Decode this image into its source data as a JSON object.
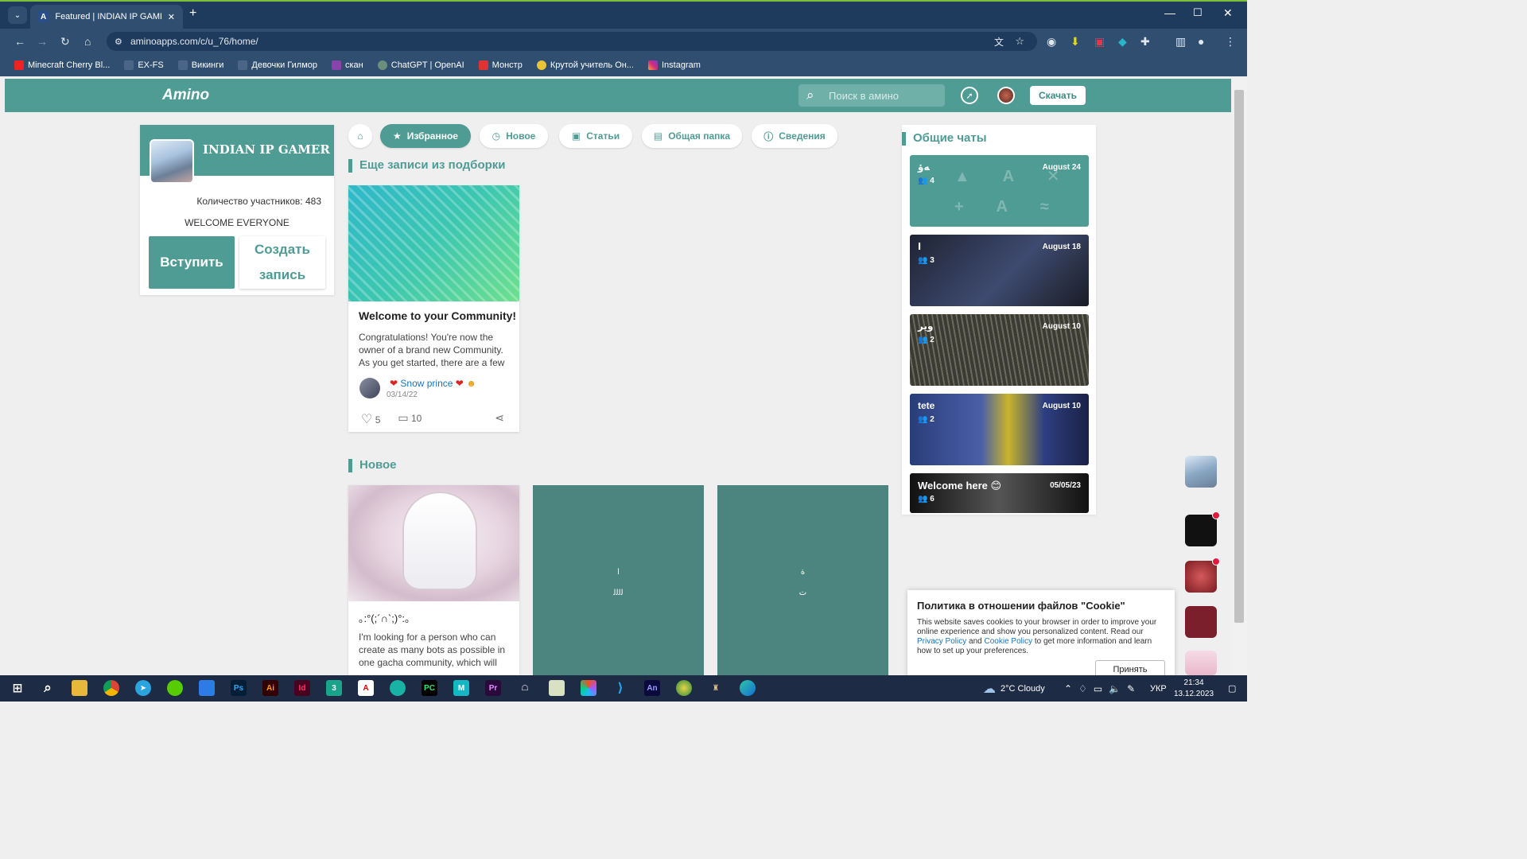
{
  "browser": {
    "tab_title": "Featured | INDIAN IP GAMER /",
    "url": "aminoapps.com/c/u_76/home/",
    "bookmarks": [
      "Minecraft Cherry Bl...",
      "EX-FS",
      "Викинги",
      "Девочки Гилмор",
      "скан",
      "ChatGPT | OpenAI",
      "Монстр",
      "Крутой учитель Он...",
      "Instagram"
    ]
  },
  "header": {
    "logo": "Amino",
    "search_placeholder": "Поиск в амино",
    "download_label": "Скачать"
  },
  "community": {
    "name": "INDIAN IP GAMER",
    "members": "Количество участников: 483",
    "welcome": "WELCOME EVERYONE",
    "join_label": "Вступить",
    "create_label": "Создать запись"
  },
  "nav": {
    "tabs": [
      {
        "label": "Избранное",
        "icon": "star-icon"
      },
      {
        "label": "Новое",
        "icon": "clock-icon"
      },
      {
        "label": "Статьи",
        "icon": "article-icon"
      },
      {
        "label": "Общая папка",
        "icon": "folder-icon"
      },
      {
        "label": "Сведения",
        "icon": "info-icon"
      }
    ]
  },
  "featured": {
    "section_title": "Еще записи из подборки",
    "post": {
      "title": "Welcome to your Community!",
      "text": "Congratulations! You're now the owner of a brand new Community. As you get started, there are a few",
      "author": "Snow prince",
      "date": "03/14/22",
      "likes": "5",
      "comments": "10"
    }
  },
  "new_section": {
    "title": "Новое",
    "posts": [
      {
        "title": "｡:°(;´∩`;)°:｡",
        "text": "I'm looking for a person who can create as many bots as possible in one gacha community, which will"
      },
      {
        "line1": "ا",
        "line2": "ﻟﻟﻟﻟ"
      },
      {
        "line1": "ة",
        "line2": "ت"
      }
    ]
  },
  "chats": {
    "title": "Общие чаты",
    "items": [
      {
        "name": "ﻪؤ",
        "count": "4",
        "date": "August 24",
        "color": "#4f9c94"
      },
      {
        "name": "ا",
        "count": "3",
        "date": "August 18",
        "color": "#3b4258"
      },
      {
        "name": "وير",
        "count": "2",
        "date": "August 10",
        "color": "#5a5a4e"
      },
      {
        "name": "tete",
        "count": "2",
        "date": "August 10",
        "color": "#3a4f86"
      },
      {
        "name": "Welcome here 😊",
        "count": "6",
        "date": "05/05/23",
        "color": "#222"
      }
    ]
  },
  "cookie": {
    "title": "Политика в отношении файлов \"Cookie\"",
    "text_1": "This website saves cookies to your browser in order to improve your online experience and show you personalized content. Read our ",
    "privacy": "Privacy Policy",
    "and": " and ",
    "cookie_policy": "Cookie Policy",
    "text_2": " to get more information and learn how to set up your preferences.",
    "accept": "Принять"
  },
  "taskbar": {
    "weather": "2°C  Cloudy",
    "lang": "УКР",
    "time": "21:34",
    "date": "13.12.2023"
  }
}
